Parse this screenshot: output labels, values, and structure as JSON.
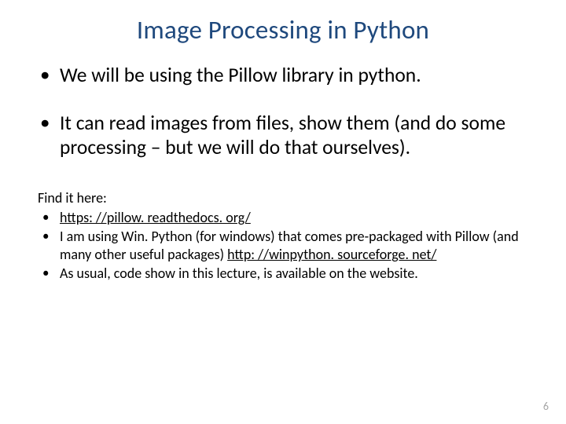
{
  "title": "Image Processing in Python",
  "main_bullets": [
    "We will be using the Pillow library in python.",
    "It can read images from files, show them (and do some processing – but we will do that ourselves)."
  ],
  "sub_intro": "Find it here:",
  "sub_bullets": {
    "b0_link": "https: //pillow. readthedocs. org/",
    "b1_pre": "I am using Win. Python (for windows) that comes pre-packaged with Pillow (and many other useful packages) ",
    "b1_link": "http: //winpython. sourceforge. net/",
    "b2": "As usual, code show in this lecture, is available on the website."
  },
  "page_number": "6"
}
